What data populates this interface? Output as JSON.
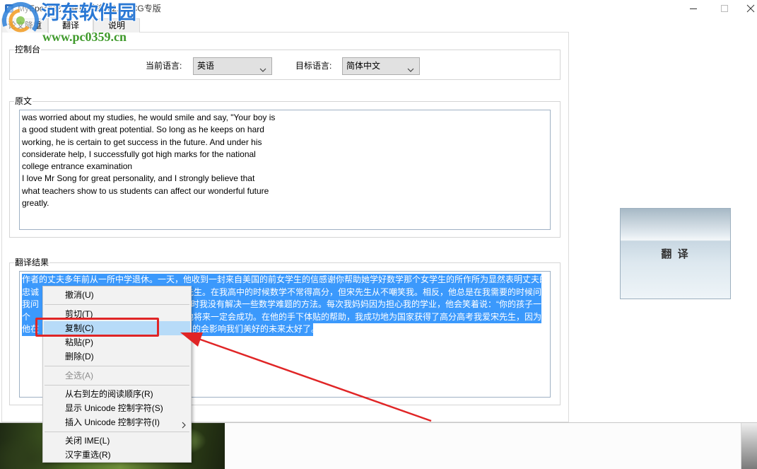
{
  "window": {
    "title": "MyEpoch论文降重系统 V2.0-LCG专版",
    "icons": [
      "app-icon",
      "minimize-icon",
      "maximize-icon",
      "close-icon"
    ]
  },
  "watermark": {
    "site_name": "河东软件园",
    "site_url": "www.pc0359.cn",
    "logo_icon": "site-logo-icon"
  },
  "tabs": [
    {
      "label": "论文降重",
      "selected": false
    },
    {
      "label": "翻译",
      "selected": true
    },
    {
      "label": "说明",
      "selected": false
    }
  ],
  "control_panel": {
    "group_label": "控制台",
    "source_language_label": "当前语言:",
    "source_language_value": "英语",
    "target_language_label": "目标语言:",
    "target_language_value": "简体中文",
    "dropdown_icon": "chevron-down-icon"
  },
  "source": {
    "group_label": "原文",
    "lines": [
      "was worried about my studies, he would smile and say, \"Your boy is",
      "a good student with great potential. So long as he keeps on hard",
      "working, he is certain to get success in the future. And under his",
      "considerate help, I successfully got high marks for the national",
      "college entrance examination",
      "I love Mr Song for great personality, and I strongly believe that",
      "what teachers show to us students can affect our wonderful future",
      "greatly."
    ]
  },
  "result": {
    "group_label": "翻译结果",
    "text_selected": true,
    "lines": [
      {
        "left": "作者的丈夫多年前从一所中学退休。一天，他收到一封来自美国的前女学生的信感谢你帮助她学好数学那个女学生的所作所为显然表明丈夫的",
        "right": ""
      },
      {
        "left": "忠诚",
        "right": "宋先生。在我高中的时候数学不常得高分，但宋先生从不嘲笑我。相反，他总是在我需要的时候问"
      },
      {
        "left": "我问",
        "right": "时我没有解决一些数学难题的方法。每次我妈妈因为担心我的学业，他会笑着说：“你的孩子一"
      },
      {
        "left": "个",
        "right": "他将来一定会成功。在他的手下体贴的帮助，我成功地为国家获得了高分高考我爱宋先生，因为"
      },
      {
        "left": "他在",
        "right": "的会影响我们美好的未来太好了。"
      }
    ]
  },
  "translate_button": {
    "label": "翻 译"
  },
  "context_menu": {
    "items": [
      {
        "label": "撤消(U)",
        "disabled": false
      },
      {
        "label": "剪切(T)",
        "disabled": false
      },
      {
        "label": "复制(C)",
        "disabled": false,
        "highlighted": true
      },
      {
        "label": "粘贴(P)",
        "disabled": false
      },
      {
        "label": "删除(D)",
        "disabled": false
      },
      {
        "label": "全选(A)",
        "disabled": true
      },
      {
        "label": "从右到左的阅读顺序(R)",
        "disabled": false
      },
      {
        "label": "显示 Unicode 控制字符(S)",
        "disabled": false
      },
      {
        "label": "插入 Unicode 控制字符(I)",
        "disabled": false,
        "has_submenu": true
      },
      {
        "label": "关闭 IME(L)",
        "disabled": false
      },
      {
        "label": "汉字重选(R)",
        "disabled": false
      }
    ],
    "submenu_icon": "chevron-right-icon"
  },
  "colors": {
    "selection": "#3b99fc",
    "menu_highlight": "#b7dbf8",
    "annotation": "#e02526",
    "disabled_text": "#8c8c8c",
    "watermark_blue": "#2a78d4",
    "watermark_green": "#3f9a2b"
  }
}
